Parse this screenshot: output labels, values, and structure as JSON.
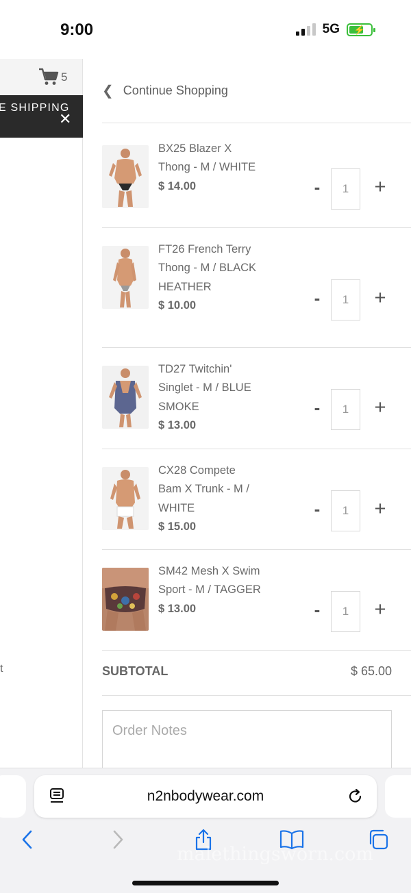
{
  "status": {
    "time": "9:00",
    "network": "5G"
  },
  "left_panel": {
    "cart_count": "5",
    "banner_text": "E SHIPPING",
    "fragment": "t"
  },
  "cart": {
    "continue_label": "Continue Shopping",
    "items": [
      {
        "name": "BX25 Blazer X Thong - M / WHITE",
        "price": "$ 14.00",
        "qty": "1"
      },
      {
        "name": "FT26 French Terry Thong - M / BLACK HEATHER",
        "price": "$ 10.00",
        "qty": "1"
      },
      {
        "name": "TD27 Twitchin' Singlet - M / BLUE SMOKE",
        "price": "$ 13.00",
        "qty": "1"
      },
      {
        "name": "CX28 Compete Bam X Trunk - M / WHITE",
        "price": "$ 15.00",
        "qty": "1"
      },
      {
        "name": "SM42 Mesh X Swim Sport - M / TAGGER",
        "price": "$ 13.00",
        "qty": "1"
      }
    ],
    "qty_minus": "-",
    "qty_plus": "+",
    "subtotal_label": "SUBTOTAL",
    "subtotal_value": "$ 65.00",
    "notes_placeholder": "Order Notes"
  },
  "browser": {
    "url": "n2nbodywear.com",
    "watermark": "malethingsworn.com"
  },
  "colors": {
    "accent_battery": "#3bbf3b",
    "banner_bg": "#2a2a2a",
    "ios_blue": "#1a73e8"
  }
}
